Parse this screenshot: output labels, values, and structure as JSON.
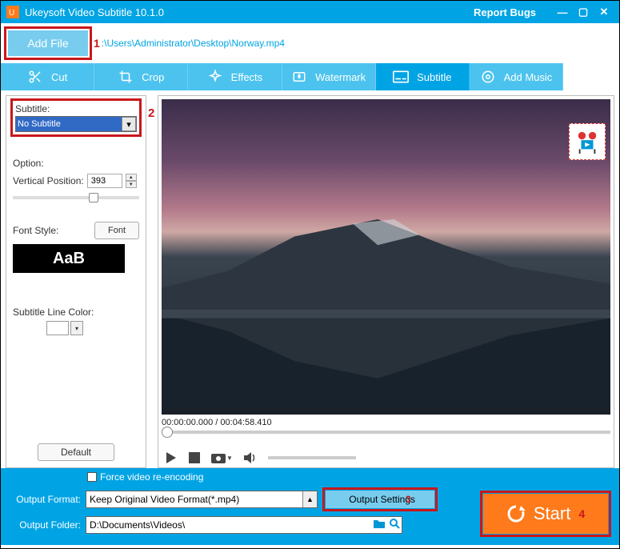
{
  "titlebar": {
    "title": "Ukeysoft Video Subtitle 10.1.0",
    "report": "Report Bugs"
  },
  "addfile": {
    "label": "Add File",
    "path": ":\\Users\\Administrator\\Desktop\\Norway.mp4",
    "annot": "1"
  },
  "tabs": [
    {
      "label": "Cut"
    },
    {
      "label": "Crop"
    },
    {
      "label": "Effects"
    },
    {
      "label": "Watermark"
    },
    {
      "label": "Subtitle",
      "active": true
    },
    {
      "label": "Add Music"
    }
  ],
  "side": {
    "subtitle_label": "Subtitle:",
    "subtitle_value": "No Subtitle",
    "annot2": "2",
    "option_label": "Option:",
    "vp_label": "Vertical Position:",
    "vp_value": "393",
    "fontstyle_label": "Font Style:",
    "font_btn": "Font",
    "font_preview": "AaB",
    "linecolor_label": "Subtitle Line Color:",
    "default_btn": "Default"
  },
  "preview": {
    "time": "00:00:00.000 / 00:04:58.410"
  },
  "bottom": {
    "force_label": "Force video re-encoding",
    "of_label": "Output Format:",
    "of_value": "Keep Original Video Format(*.mp4)",
    "os_btn": "Output Settings",
    "annot3": "3",
    "folder_label": "Output Folder:",
    "folder_value": "D:\\Documents\\Videos\\",
    "start": "Start",
    "annot4": "4"
  }
}
